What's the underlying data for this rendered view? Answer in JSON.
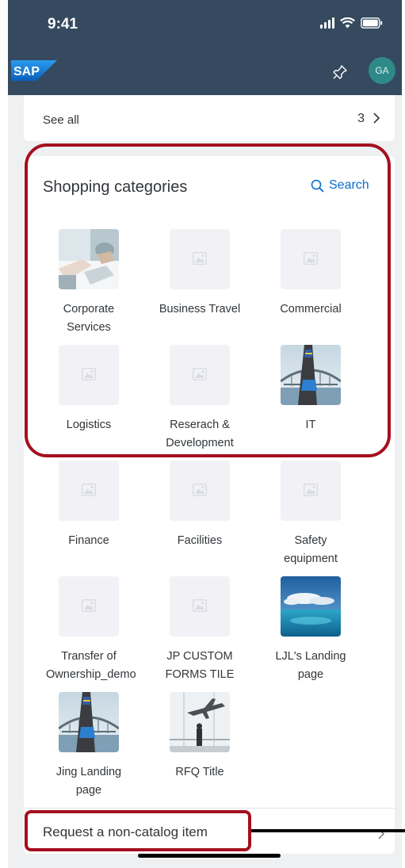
{
  "status_bar": {
    "time": "9:41"
  },
  "shell_bar": {
    "logo_text": "SAP",
    "avatar_initials": "GA"
  },
  "see_all_card": {
    "label": "See all",
    "count": "3"
  },
  "shopping_categories": {
    "title": "Shopping categories",
    "search_label": "Search",
    "tiles": [
      {
        "label": "Corporate Services",
        "image": "photo-business-meeting"
      },
      {
        "label": "Business Travel",
        "image": "placeholder-icon"
      },
      {
        "label": "Commercial",
        "image": "placeholder-icon"
      },
      {
        "label": "Logistics",
        "image": "placeholder-icon"
      },
      {
        "label": "Reserach & Development",
        "image": "placeholder-icon"
      },
      {
        "label": "IT",
        "image": "photo-sail-bridge"
      },
      {
        "label": "Finance",
        "image": "placeholder-icon"
      },
      {
        "label": "Facilities",
        "image": "placeholder-icon"
      },
      {
        "label": "Safety equipment",
        "image": "placeholder-icon"
      },
      {
        "label": "Transfer of Ownership_demo",
        "image": "placeholder-icon"
      },
      {
        "label": "JP CUSTOM FORMS TILE",
        "image": "placeholder-icon"
      },
      {
        "label": "LJL's Landing page",
        "image": "photo-sea-sky"
      },
      {
        "label": "Jing Landing page",
        "image": "photo-sail-bridge"
      },
      {
        "label": "RFQ Title",
        "image": "photo-airplane-window"
      }
    ]
  },
  "request_item": {
    "label": "Request a non-catalog item"
  },
  "colors": {
    "shell": "#354a5f",
    "accent": "#0a6ed1",
    "highlight": "#a50f1e",
    "avatar": "#2e8a88"
  }
}
